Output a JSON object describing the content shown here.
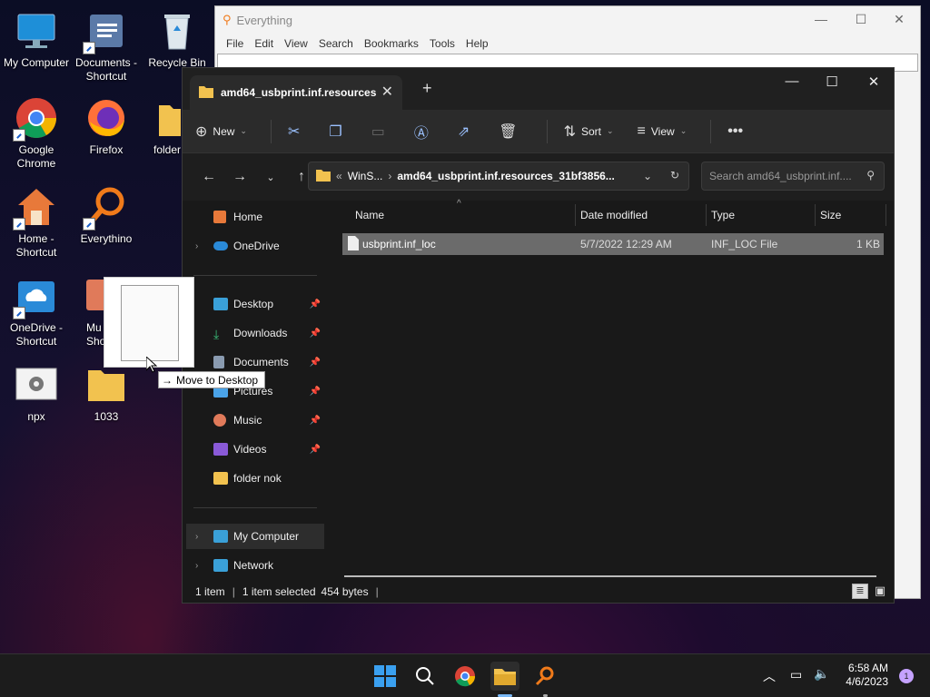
{
  "desktop": {
    "icons": [
      {
        "label": "My Computer"
      },
      {
        "label": "Documents - Shortcut"
      },
      {
        "label": "Recycle Bin"
      },
      {
        "label": "Google Chrome"
      },
      {
        "label": "Firefox"
      },
      {
        "label": "folder"
      },
      {
        "label": "Home - Shortcut"
      },
      {
        "label": "Everythino"
      },
      {
        "label": "OneDrive - Shortcut"
      },
      {
        "label": "Mu Sho"
      },
      {
        "label": "npx"
      },
      {
        "label": "1033"
      }
    ]
  },
  "everything": {
    "title": "Everything",
    "menu": [
      "File",
      "Edit",
      "View",
      "Search",
      "Bookmarks",
      "Tools",
      "Help"
    ]
  },
  "explorer": {
    "tab_title": "amd64_usbprint.inf.resources",
    "commands": {
      "new": "New",
      "sort": "Sort",
      "view": "View"
    },
    "breadcrumb": {
      "prefix": "«",
      "part1": "WinS...",
      "part2": "amd64_usbprint.inf.resources_31bf3856..."
    },
    "search_placeholder": "Search amd64_usbprint.inf....",
    "nav": {
      "home": "Home",
      "onedrive": "OneDrive",
      "desktop": "Desktop",
      "downloads": "Downloads",
      "documents": "Documents",
      "pictures": "Pictures",
      "music": "Music",
      "videos": "Videos",
      "folder_nok": "folder nok",
      "my_computer": "My Computer",
      "network": "Network"
    },
    "columns": {
      "name": "Name",
      "date": "Date modified",
      "type": "Type",
      "size": "Size"
    },
    "files": [
      {
        "name": "usbprint.inf_loc",
        "date": "5/7/2022 12:29 AM",
        "type": "INF_LOC File",
        "size": "1 KB"
      }
    ],
    "status": {
      "items": "1 item",
      "selected": "1 item selected",
      "bytes": "454 bytes"
    }
  },
  "drag": {
    "tooltip": "Move to Desktop"
  },
  "taskbar": {
    "time": "6:58 AM",
    "date": "4/6/2023",
    "notifications": "1"
  }
}
